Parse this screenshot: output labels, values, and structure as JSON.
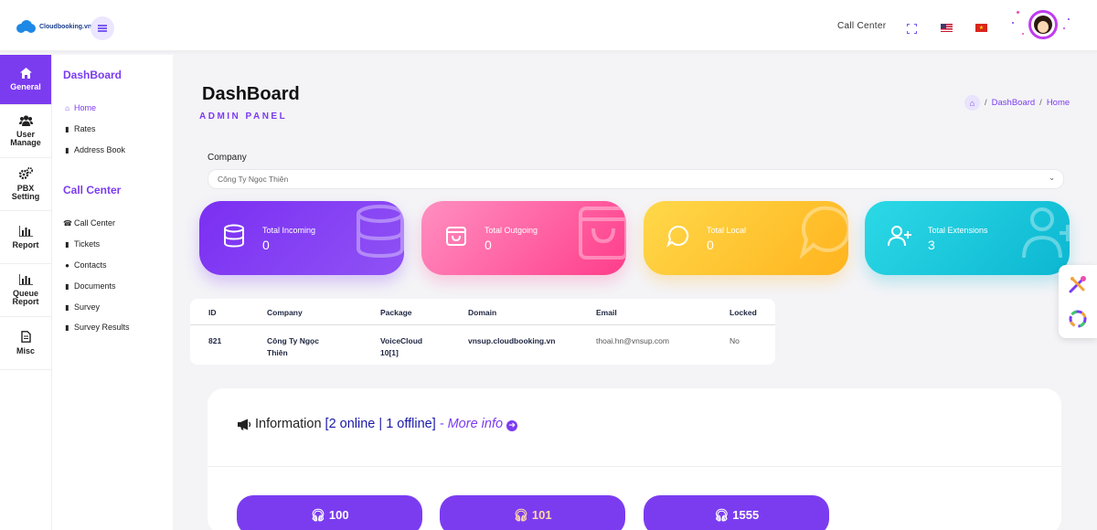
{
  "header": {
    "logo_text": "Cloudbooking.vn",
    "callcenter_label": "Call Center",
    "flags": [
      "us-flag-icon",
      "vn-flag-icon"
    ]
  },
  "rail": [
    {
      "label": "General",
      "icon": "home-icon",
      "active": true
    },
    {
      "label": "User Manage",
      "icon": "users-icon",
      "active": false
    },
    {
      "label": "PBX Setting",
      "icon": "cogs-icon",
      "active": false
    },
    {
      "label": "Report",
      "icon": "bar-chart-icon",
      "active": false
    },
    {
      "label": "Queue Report",
      "icon": "bar-chart-icon",
      "active": false
    },
    {
      "label": "Misc",
      "icon": "document-icon",
      "active": false
    }
  ],
  "submenu": {
    "dashboard_heading": "DashBoard",
    "dashboard_items": [
      "Home",
      "Rates",
      "Address Book"
    ],
    "callcenter_heading": "Call Center",
    "callcenter_items": [
      "Call Center",
      "Tickets",
      "Contacts",
      "Documents",
      "Survey",
      "Survey Results"
    ]
  },
  "page": {
    "title": "DashBoard",
    "subtitle": "ADMIN PANEL",
    "breadcrumb": [
      "DashBoard",
      "Home"
    ],
    "breadcrumb_sep": "/"
  },
  "company": {
    "label": "Company",
    "selected": "Công Ty Ngọc Thiên"
  },
  "stats": [
    {
      "label": "Total Incoming",
      "value": "0",
      "icon": "database-icon",
      "color": "#7b2ff2"
    },
    {
      "label": "Total Outgoing",
      "value": "0",
      "icon": "shopping-bag-icon",
      "color": "#ff3d8a"
    },
    {
      "label": "Total Local",
      "value": "0",
      "icon": "chat-bubble-icon",
      "color": "#ffb41e"
    },
    {
      "label": "Total Extensions",
      "value": "3",
      "icon": "user-plus-icon",
      "color": "#0cb7d1"
    }
  ],
  "table": {
    "columns": [
      "ID",
      "Company",
      "Package",
      "Domain",
      "Email",
      "Locked"
    ],
    "rows": [
      {
        "id": "821",
        "company_l1": "Công Ty Ngọc",
        "company_l2": "Thiên",
        "package_l1": "VoiceCloud",
        "package_l2": "10[1]",
        "domain": "vnsup.cloudbooking.vn",
        "email": "thoai.hn@vnsup.com",
        "locked": "No"
      }
    ]
  },
  "info": {
    "label": "Information",
    "status": "[2 online | 1 offline]",
    "more": "- More info"
  },
  "extensions": [
    "100",
    "101",
    "1555"
  ],
  "colors": {
    "accent": "#7b3cf0",
    "status_blue": "#1a1aa8"
  }
}
